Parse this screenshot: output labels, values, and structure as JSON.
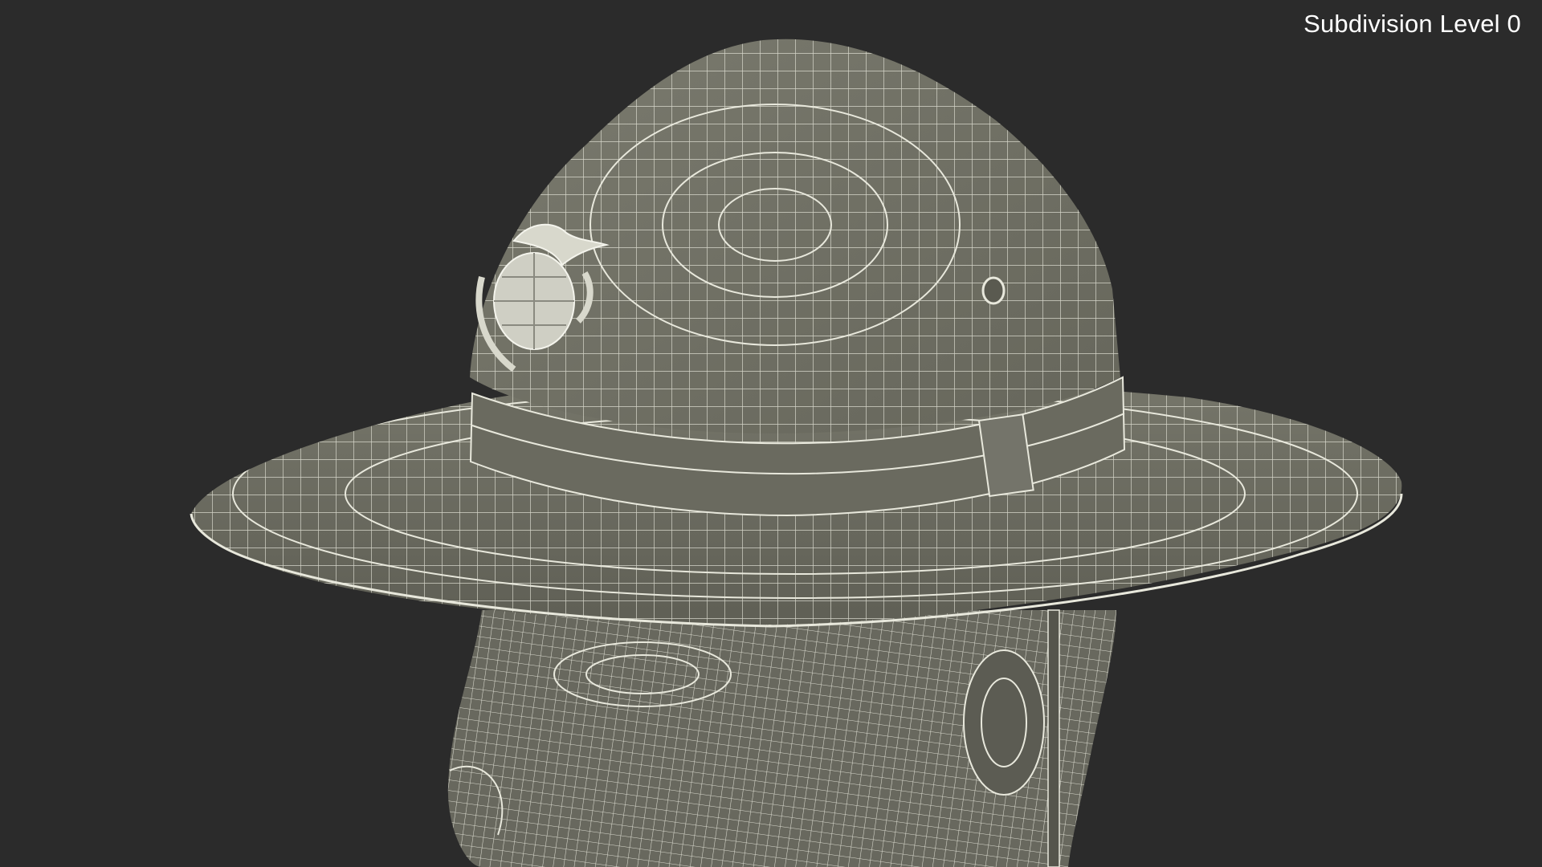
{
  "viewport": {
    "background_color": "#2b2b2b",
    "overlay_label": "Subdivision Level 0"
  },
  "render": {
    "subject": "wireframe-head-with-campaign-hat",
    "mesh_color": "#6e6e62",
    "wire_color": "#e8e8dc",
    "emblem_color": "#cfcfc4"
  }
}
